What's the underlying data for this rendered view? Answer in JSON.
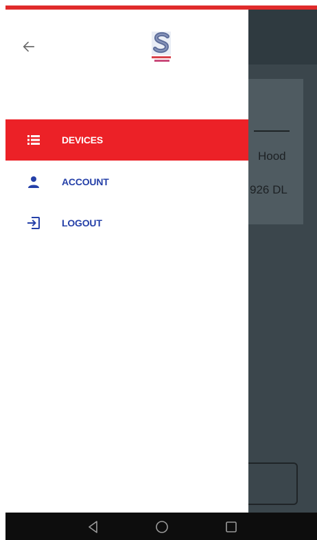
{
  "background_app": {
    "card_title": "Hood",
    "card_subtitle": "926 DL"
  },
  "drawer": {
    "back_icon": "arrow-left-icon",
    "logo_icon": "app-logo-icon",
    "menu": [
      {
        "label": "DEVICES",
        "icon": "list-icon",
        "active": true
      },
      {
        "label": "ACCOUNT",
        "icon": "person-icon",
        "active": false
      },
      {
        "label": "LOGOUT",
        "icon": "logout-icon",
        "active": false
      }
    ]
  },
  "system_nav": {
    "back_icon": "nav-back-icon",
    "home_icon": "nav-home-icon",
    "recents_icon": "nav-recents-icon"
  },
  "colors": {
    "accent_red": "#ec2127",
    "link_blue": "#2540a8",
    "scrim": "#3e4a51"
  }
}
